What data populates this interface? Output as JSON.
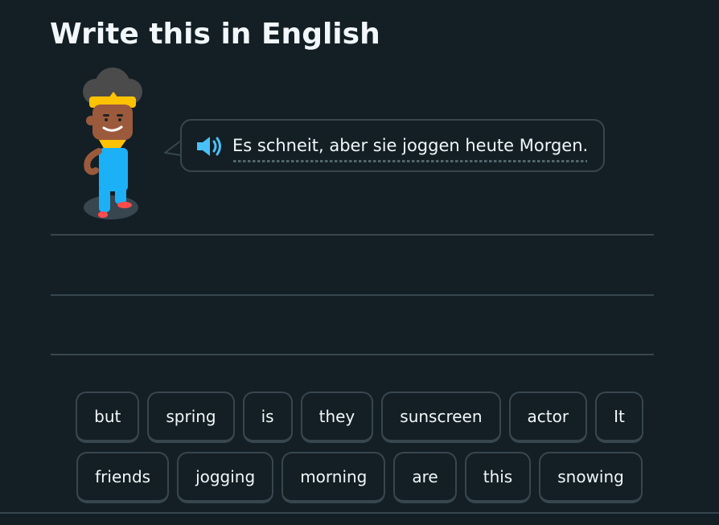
{
  "challenge": {
    "title": "Write this in English"
  },
  "prompt": {
    "speaker_icon": "speaker-icon",
    "text": "Es schneit, aber sie joggen heute Morgen."
  },
  "word_bank": {
    "row1": [
      "but",
      "spring",
      "is",
      "they",
      "sunscreen",
      "actor",
      "It"
    ],
    "row2": [
      "friends",
      "jogging",
      "morning",
      "are",
      "this",
      "snowing"
    ]
  },
  "colors": {
    "background": "#131f24",
    "border": "#37464f",
    "text": "#f1f7fb",
    "speaker_blue": "#49c0f8"
  }
}
